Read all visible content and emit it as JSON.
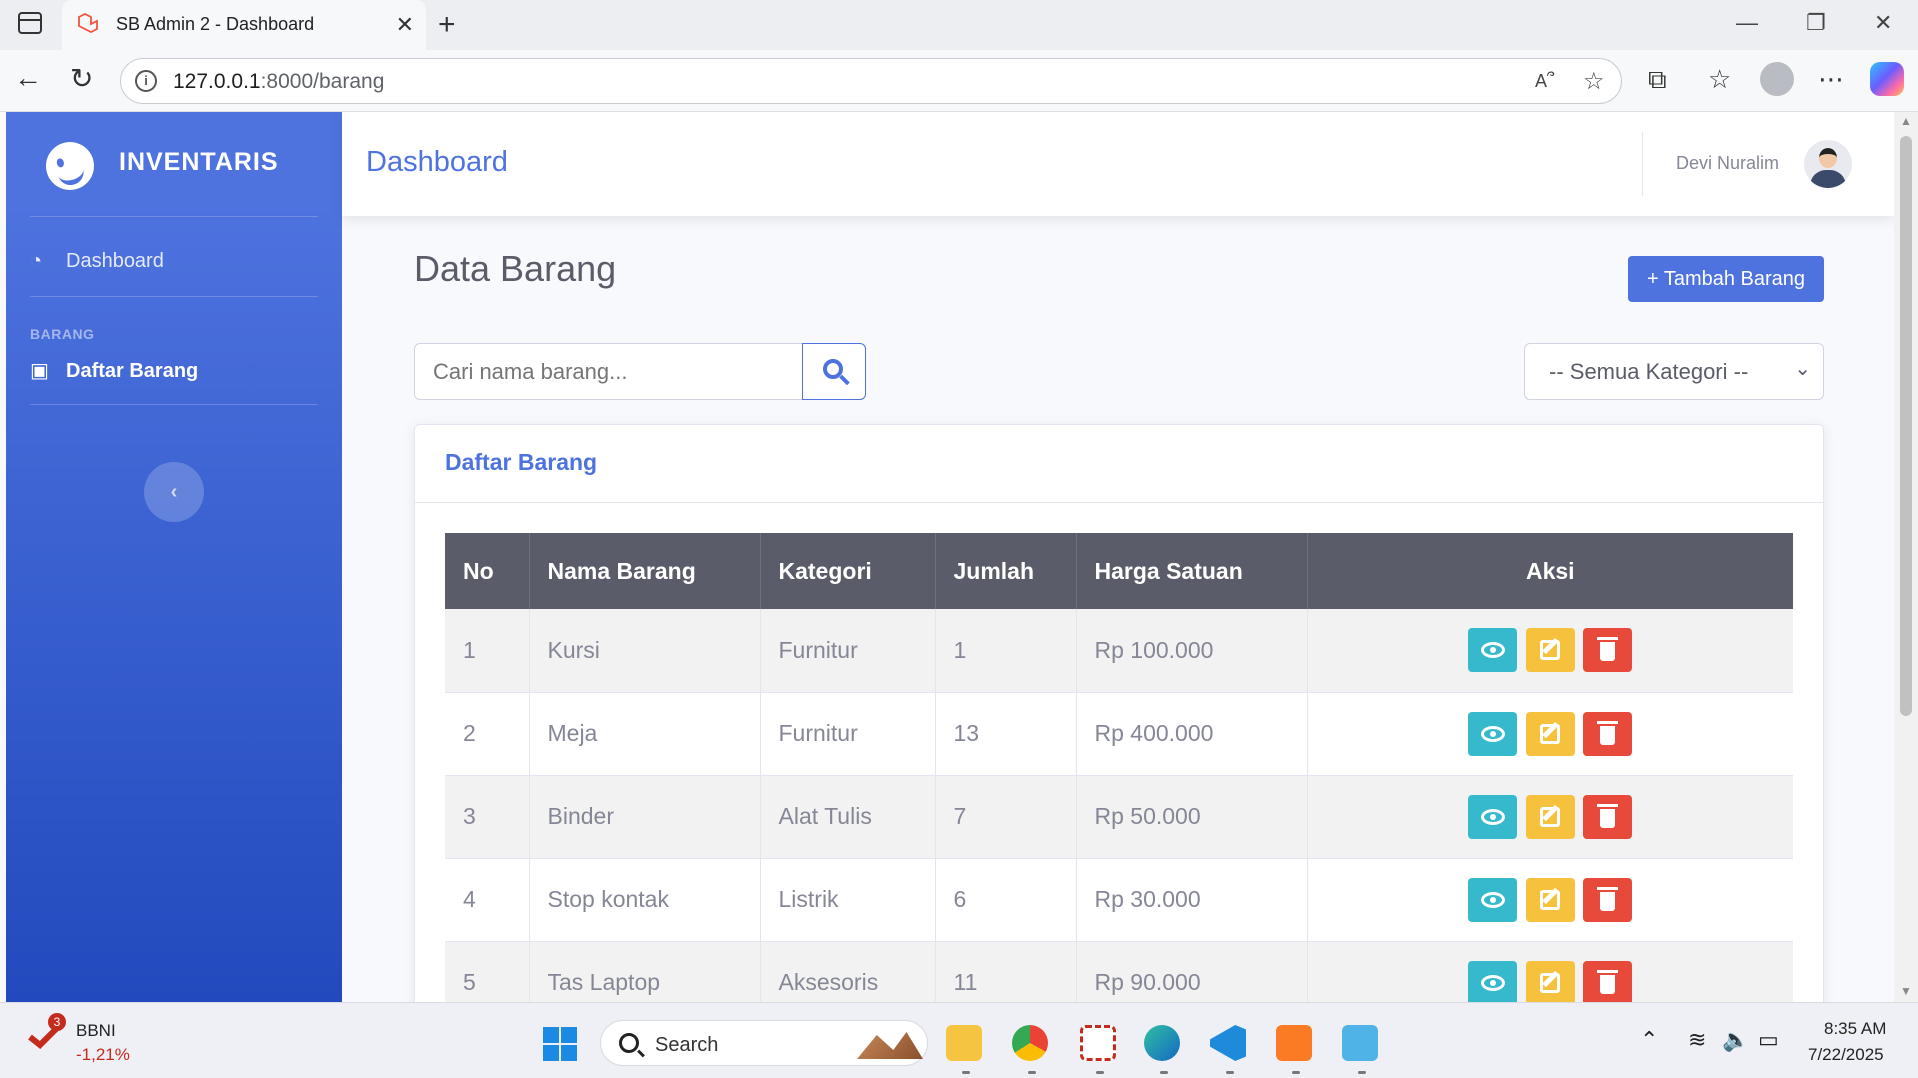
{
  "browser": {
    "tab_title": "SB Admin 2 - Dashboard",
    "url_host": "127.0.0.1",
    "url_rest": ":8000/barang"
  },
  "sidebar": {
    "brand": "INVENTARIS",
    "items": [
      {
        "label": "Dashboard",
        "icon": "tachometer-icon"
      },
      {
        "label": "Daftar Barang",
        "icon": "box-icon",
        "active": true
      }
    ],
    "heading": "BARANG",
    "toggler_icon": "chevron-left-icon"
  },
  "topbar": {
    "title": "Dashboard",
    "user_name": "Devi Nuralim"
  },
  "main": {
    "page_title": "Data Barang",
    "add_button": "Tambah Barang",
    "search_placeholder": "Cari nama barang...",
    "category_select": "-- Semua Kategori --",
    "card_title": "Daftar Barang",
    "table": {
      "columns": [
        "No",
        "Nama Barang",
        "Kategori",
        "Jumlah",
        "Harga Satuan",
        "Aksi"
      ],
      "rows": [
        {
          "no": "1",
          "nama": "Kursi",
          "kategori": "Furnitur",
          "jumlah": "1",
          "harga": "Rp 100.000"
        },
        {
          "no": "2",
          "nama": "Meja",
          "kategori": "Furnitur",
          "jumlah": "13",
          "harga": "Rp 400.000"
        },
        {
          "no": "3",
          "nama": "Binder",
          "kategori": "Alat Tulis",
          "jumlah": "7",
          "harga": "Rp 50.000"
        },
        {
          "no": "4",
          "nama": "Stop kontak",
          "kategori": "Listrik",
          "jumlah": "6",
          "harga": "Rp 30.000"
        },
        {
          "no": "5",
          "nama": "Tas Laptop",
          "kategori": "Aksesoris",
          "jumlah": "11",
          "harga": "Rp 90.000"
        }
      ]
    }
  },
  "taskbar": {
    "stock_badge": "3",
    "stock_name": "BBNI",
    "stock_change": "-1,21%",
    "search_label": "Search",
    "time": "8:35 AM",
    "date": "7/22/2025"
  },
  "colors": {
    "primary": "#4e73df",
    "info": "#36b9cc",
    "warning": "#f6c23e",
    "danger": "#e74a3b",
    "table_header": "#5a5c69"
  }
}
